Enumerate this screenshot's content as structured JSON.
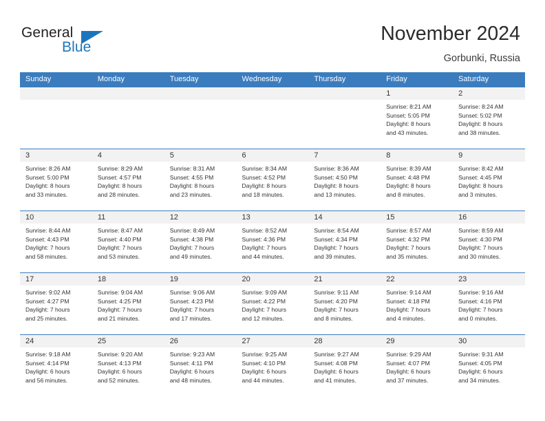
{
  "brand": {
    "name_part1": "General",
    "name_part2": "Blue",
    "triangle_color": "#1b75bb"
  },
  "header": {
    "title": "November 2024",
    "subtitle": "Gorbunki, Russia",
    "accent_color": "#3b7cbe",
    "band_color": "#f2f2f2"
  },
  "weekday_headers": [
    "Sunday",
    "Monday",
    "Tuesday",
    "Wednesday",
    "Thursday",
    "Friday",
    "Saturday"
  ],
  "weeks": [
    [
      {
        "day": "",
        "empty": true
      },
      {
        "day": "",
        "empty": true
      },
      {
        "day": "",
        "empty": true
      },
      {
        "day": "",
        "empty": true
      },
      {
        "day": "",
        "empty": true
      },
      {
        "day": "1",
        "sunrise": "Sunrise: 8:21 AM",
        "sunset": "Sunset: 5:05 PM",
        "daylight_line1": "Daylight: 8 hours",
        "daylight_line2": "and 43 minutes."
      },
      {
        "day": "2",
        "sunrise": "Sunrise: 8:24 AM",
        "sunset": "Sunset: 5:02 PM",
        "daylight_line1": "Daylight: 8 hours",
        "daylight_line2": "and 38 minutes."
      }
    ],
    [
      {
        "day": "3",
        "sunrise": "Sunrise: 8:26 AM",
        "sunset": "Sunset: 5:00 PM",
        "daylight_line1": "Daylight: 8 hours",
        "daylight_line2": "and 33 minutes."
      },
      {
        "day": "4",
        "sunrise": "Sunrise: 8:29 AM",
        "sunset": "Sunset: 4:57 PM",
        "daylight_line1": "Daylight: 8 hours",
        "daylight_line2": "and 28 minutes."
      },
      {
        "day": "5",
        "sunrise": "Sunrise: 8:31 AM",
        "sunset": "Sunset: 4:55 PM",
        "daylight_line1": "Daylight: 8 hours",
        "daylight_line2": "and 23 minutes."
      },
      {
        "day": "6",
        "sunrise": "Sunrise: 8:34 AM",
        "sunset": "Sunset: 4:52 PM",
        "daylight_line1": "Daylight: 8 hours",
        "daylight_line2": "and 18 minutes."
      },
      {
        "day": "7",
        "sunrise": "Sunrise: 8:36 AM",
        "sunset": "Sunset: 4:50 PM",
        "daylight_line1": "Daylight: 8 hours",
        "daylight_line2": "and 13 minutes."
      },
      {
        "day": "8",
        "sunrise": "Sunrise: 8:39 AM",
        "sunset": "Sunset: 4:48 PM",
        "daylight_line1": "Daylight: 8 hours",
        "daylight_line2": "and 8 minutes."
      },
      {
        "day": "9",
        "sunrise": "Sunrise: 8:42 AM",
        "sunset": "Sunset: 4:45 PM",
        "daylight_line1": "Daylight: 8 hours",
        "daylight_line2": "and 3 minutes."
      }
    ],
    [
      {
        "day": "10",
        "sunrise": "Sunrise: 8:44 AM",
        "sunset": "Sunset: 4:43 PM",
        "daylight_line1": "Daylight: 7 hours",
        "daylight_line2": "and 58 minutes."
      },
      {
        "day": "11",
        "sunrise": "Sunrise: 8:47 AM",
        "sunset": "Sunset: 4:40 PM",
        "daylight_line1": "Daylight: 7 hours",
        "daylight_line2": "and 53 minutes."
      },
      {
        "day": "12",
        "sunrise": "Sunrise: 8:49 AM",
        "sunset": "Sunset: 4:38 PM",
        "daylight_line1": "Daylight: 7 hours",
        "daylight_line2": "and 49 minutes."
      },
      {
        "day": "13",
        "sunrise": "Sunrise: 8:52 AM",
        "sunset": "Sunset: 4:36 PM",
        "daylight_line1": "Daylight: 7 hours",
        "daylight_line2": "and 44 minutes."
      },
      {
        "day": "14",
        "sunrise": "Sunrise: 8:54 AM",
        "sunset": "Sunset: 4:34 PM",
        "daylight_line1": "Daylight: 7 hours",
        "daylight_line2": "and 39 minutes."
      },
      {
        "day": "15",
        "sunrise": "Sunrise: 8:57 AM",
        "sunset": "Sunset: 4:32 PM",
        "daylight_line1": "Daylight: 7 hours",
        "daylight_line2": "and 35 minutes."
      },
      {
        "day": "16",
        "sunrise": "Sunrise: 8:59 AM",
        "sunset": "Sunset: 4:30 PM",
        "daylight_line1": "Daylight: 7 hours",
        "daylight_line2": "and 30 minutes."
      }
    ],
    [
      {
        "day": "17",
        "sunrise": "Sunrise: 9:02 AM",
        "sunset": "Sunset: 4:27 PM",
        "daylight_line1": "Daylight: 7 hours",
        "daylight_line2": "and 25 minutes."
      },
      {
        "day": "18",
        "sunrise": "Sunrise: 9:04 AM",
        "sunset": "Sunset: 4:25 PM",
        "daylight_line1": "Daylight: 7 hours",
        "daylight_line2": "and 21 minutes."
      },
      {
        "day": "19",
        "sunrise": "Sunrise: 9:06 AM",
        "sunset": "Sunset: 4:23 PM",
        "daylight_line1": "Daylight: 7 hours",
        "daylight_line2": "and 17 minutes."
      },
      {
        "day": "20",
        "sunrise": "Sunrise: 9:09 AM",
        "sunset": "Sunset: 4:22 PM",
        "daylight_line1": "Daylight: 7 hours",
        "daylight_line2": "and 12 minutes."
      },
      {
        "day": "21",
        "sunrise": "Sunrise: 9:11 AM",
        "sunset": "Sunset: 4:20 PM",
        "daylight_line1": "Daylight: 7 hours",
        "daylight_line2": "and 8 minutes."
      },
      {
        "day": "22",
        "sunrise": "Sunrise: 9:14 AM",
        "sunset": "Sunset: 4:18 PM",
        "daylight_line1": "Daylight: 7 hours",
        "daylight_line2": "and 4 minutes."
      },
      {
        "day": "23",
        "sunrise": "Sunrise: 9:16 AM",
        "sunset": "Sunset: 4:16 PM",
        "daylight_line1": "Daylight: 7 hours",
        "daylight_line2": "and 0 minutes."
      }
    ],
    [
      {
        "day": "24",
        "sunrise": "Sunrise: 9:18 AM",
        "sunset": "Sunset: 4:14 PM",
        "daylight_line1": "Daylight: 6 hours",
        "daylight_line2": "and 56 minutes."
      },
      {
        "day": "25",
        "sunrise": "Sunrise: 9:20 AM",
        "sunset": "Sunset: 4:13 PM",
        "daylight_line1": "Daylight: 6 hours",
        "daylight_line2": "and 52 minutes."
      },
      {
        "day": "26",
        "sunrise": "Sunrise: 9:23 AM",
        "sunset": "Sunset: 4:11 PM",
        "daylight_line1": "Daylight: 6 hours",
        "daylight_line2": "and 48 minutes."
      },
      {
        "day": "27",
        "sunrise": "Sunrise: 9:25 AM",
        "sunset": "Sunset: 4:10 PM",
        "daylight_line1": "Daylight: 6 hours",
        "daylight_line2": "and 44 minutes."
      },
      {
        "day": "28",
        "sunrise": "Sunrise: 9:27 AM",
        "sunset": "Sunset: 4:08 PM",
        "daylight_line1": "Daylight: 6 hours",
        "daylight_line2": "and 41 minutes."
      },
      {
        "day": "29",
        "sunrise": "Sunrise: 9:29 AM",
        "sunset": "Sunset: 4:07 PM",
        "daylight_line1": "Daylight: 6 hours",
        "daylight_line2": "and 37 minutes."
      },
      {
        "day": "30",
        "sunrise": "Sunrise: 9:31 AM",
        "sunset": "Sunset: 4:05 PM",
        "daylight_line1": "Daylight: 6 hours",
        "daylight_line2": "and 34 minutes."
      }
    ]
  ]
}
